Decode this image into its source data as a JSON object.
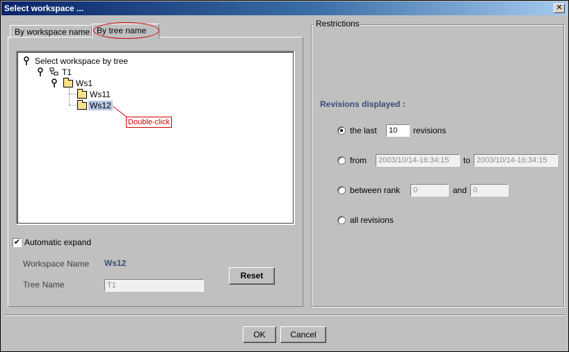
{
  "window": {
    "title": "Select workspace ...",
    "close_label": "✕"
  },
  "tabs": [
    {
      "label": "By workspace name",
      "active": false
    },
    {
      "label": "By tree name",
      "active": true
    }
  ],
  "tree": {
    "root": "Select workspace by tree",
    "tree_node": "T1",
    "ws1": "Ws1",
    "ws11": "Ws11",
    "ws12": "Ws12"
  },
  "callout": {
    "text": "Double-click"
  },
  "options": {
    "auto_expand_label": "Automatic expand",
    "auto_expand_checked": true,
    "check_mark": "✔"
  },
  "workspace": {
    "name_label": "Workspace Name",
    "name_value": "Ws12",
    "tree_label": "Tree Name",
    "tree_value": "T1",
    "reset_label": "Reset"
  },
  "restrictions": {
    "title": "Restrictions",
    "heading": "Revisions displayed :",
    "last_label": "the last",
    "last_value": "10",
    "last_suffix": "revisions",
    "from_label": "from",
    "from_value": "2003/10/14-16:34:15",
    "to_label": "to",
    "to_value": "2003/10/14-16:34:15",
    "rank_label": "between rank",
    "rank_from": "0",
    "rank_and": "and",
    "rank_to": "0",
    "all_label": "all revisions",
    "selected": "last"
  },
  "footer": {
    "ok_label": "OK",
    "cancel_label": "Cancel"
  },
  "colors": {
    "accent": "#3c4a78",
    "annotation": "#cc0000",
    "titlebar": "#0a246a"
  }
}
